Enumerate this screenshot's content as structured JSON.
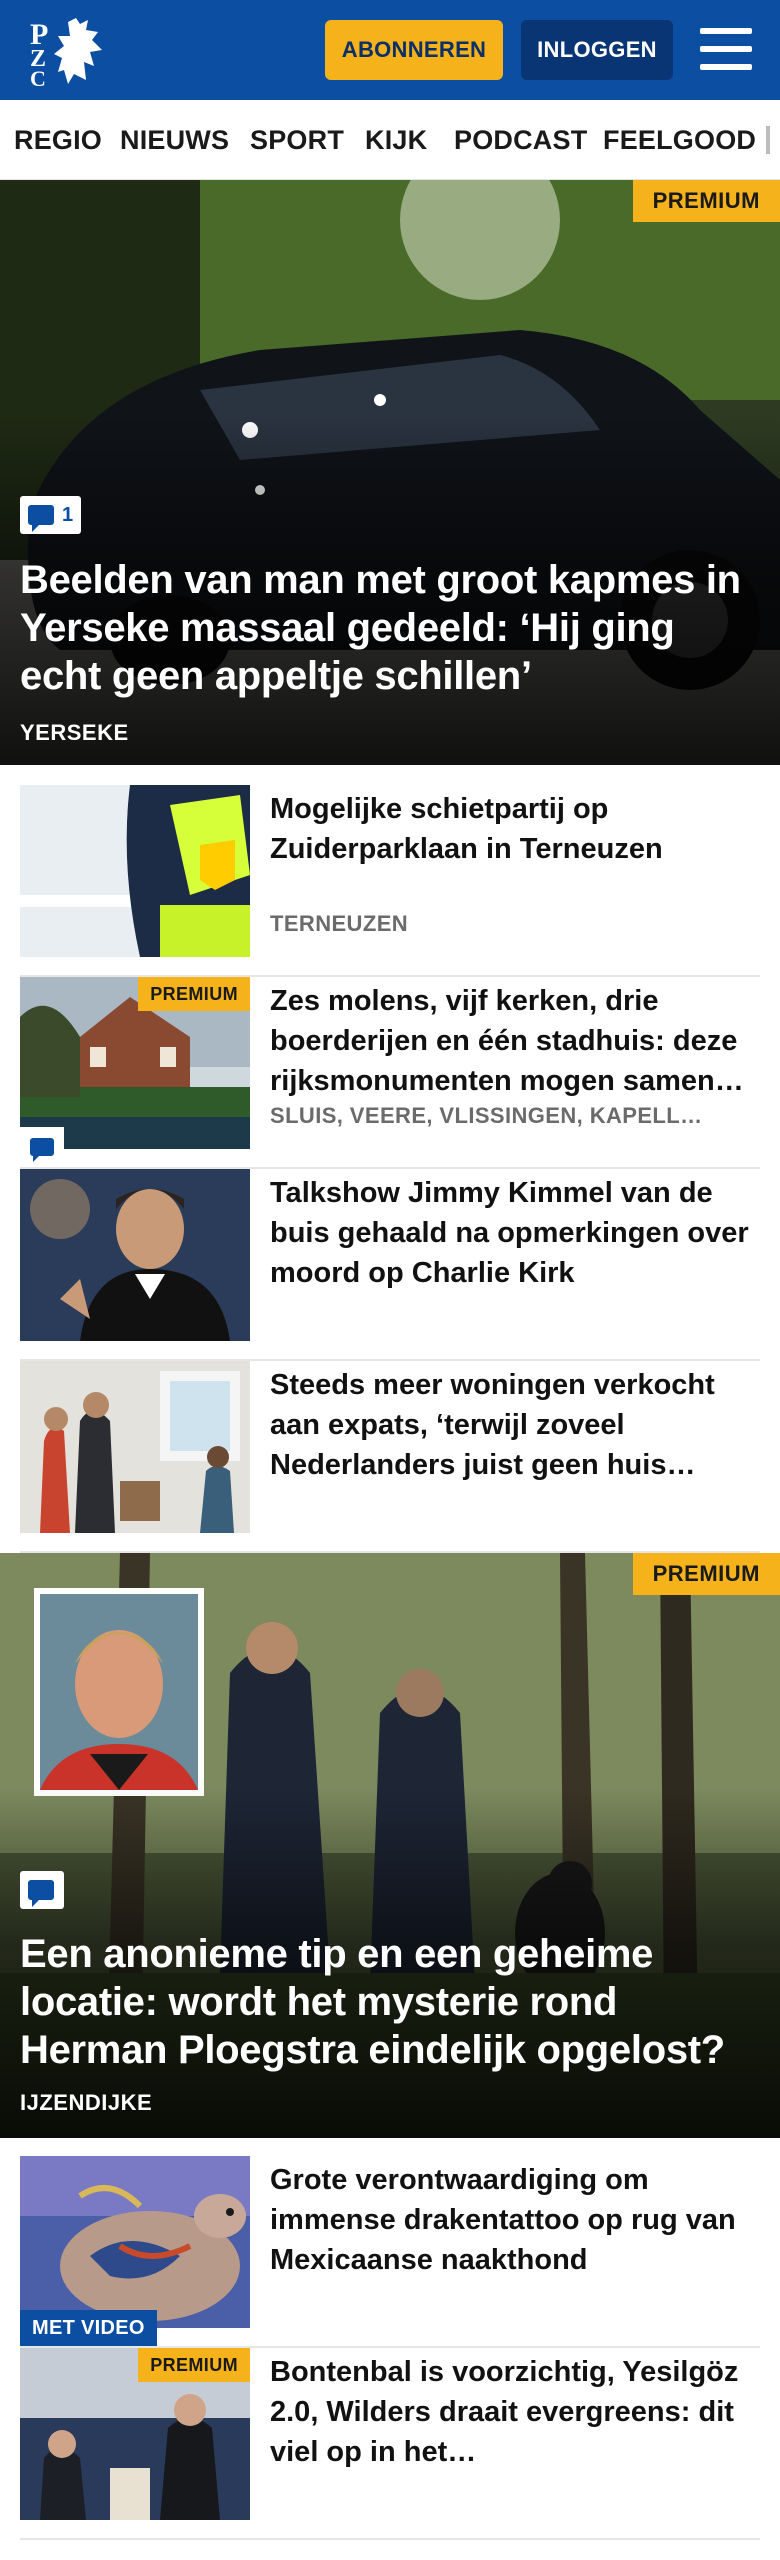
{
  "header": {
    "logo_text": "PZC",
    "subscribe_label": "ABONNEREN",
    "login_label": "INLOGGEN",
    "menu_icon": "hamburger-menu-icon",
    "brand_color": "#0b4ea2",
    "accent_color": "#f5b21a"
  },
  "nav": {
    "items": [
      "REGIO",
      "NIEUWS",
      "SPORT",
      "KIJK",
      "PODCAST",
      "FEELGOOD"
    ]
  },
  "hero1": {
    "premium": "PREMIUM",
    "comments": "1",
    "title": "Beelden van man met groot kapmes in Yerseke massaal gedeeld: ‘Hij ging echt geen appeltje schillen’",
    "location": "YERSEKE"
  },
  "articles1": [
    {
      "title": "Mogelijke schietpartij op Zuiderparklaan in Terneuzen",
      "location": "TERNEUZEN"
    },
    {
      "premium": "PREMIUM",
      "title": "Zes molens, vijf kerken, drie boerderijen en één stadhuis: deze rijksmonumenten mogen samen…",
      "location": "SLUIS, VEERE, VLISSINGEN, KAPELL…"
    },
    {
      "title": "Talkshow Jimmy Kimmel van de buis gehaald na opmerkingen over moord op Charlie Kirk"
    },
    {
      "title": "Steeds meer woningen verkocht aan expats, ‘terwijl zoveel Nederlanders juist geen huis…"
    }
  ],
  "hero2": {
    "premium": "PREMIUM",
    "title": "Een anonieme tip en een geheime locatie: wordt het mysterie rond Herman Ploegstra eindelijk opgelost?",
    "location": "IJZENDIJKE"
  },
  "articles2": [
    {
      "video": "MET VIDEO",
      "title": "Grote verontwaardiging om immense drakentattoo op rug van Mexicaanse naakthond"
    },
    {
      "premium": "PREMIUM",
      "title": "Bontenbal is voorzichtig, Yesilgöz 2.0, Wilders draait evergreens: dit viel op in het…"
    }
  ]
}
